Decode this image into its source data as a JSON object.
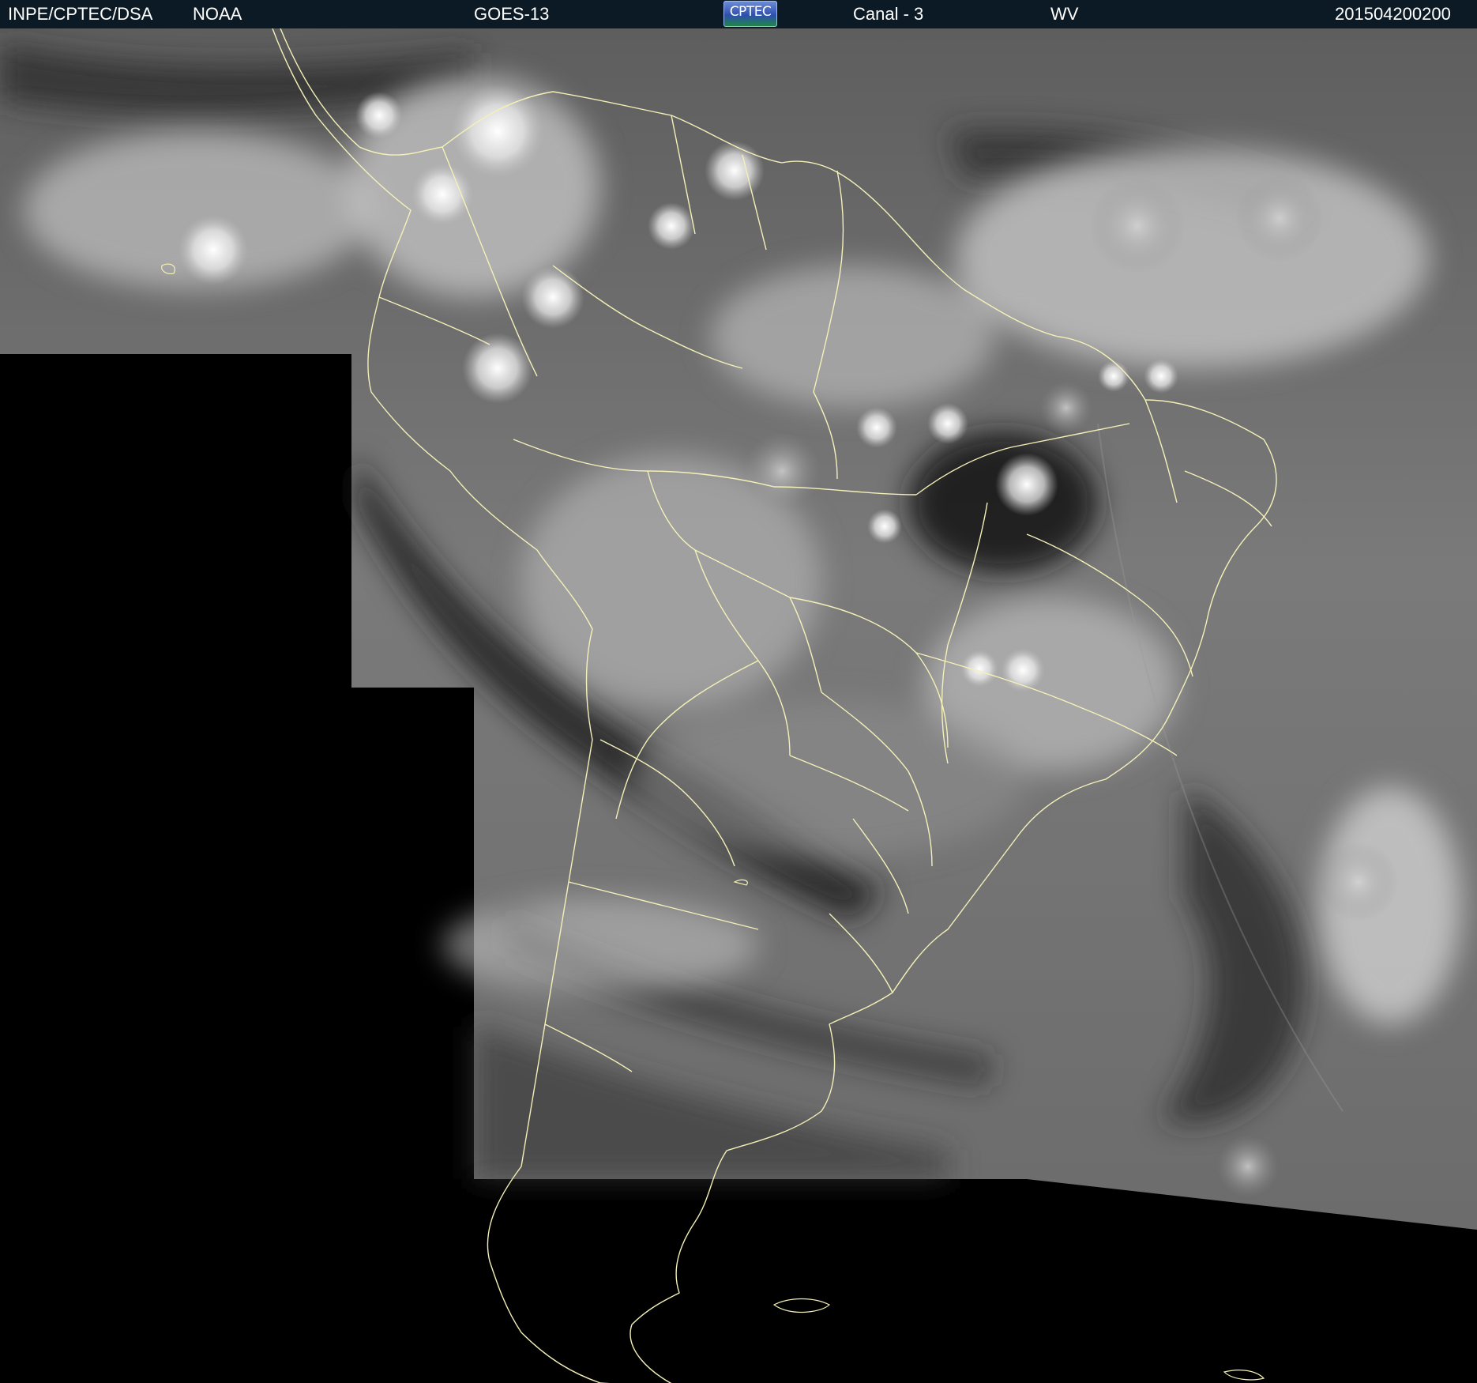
{
  "header": {
    "agency": "INPE/CPTEC/DSA",
    "source": "NOAA",
    "satellite": "GOES-13",
    "logo_text": "CPTEC",
    "channel": "Canal - 3",
    "band": "WV",
    "timestamp": "201504200200"
  },
  "image": {
    "type": "satellite water-vapor image",
    "colors": {
      "header_bg": "#0b1a24",
      "header_text": "#ffffff",
      "border_lines": "#f4f0b8",
      "no_data": "#000000"
    }
  }
}
